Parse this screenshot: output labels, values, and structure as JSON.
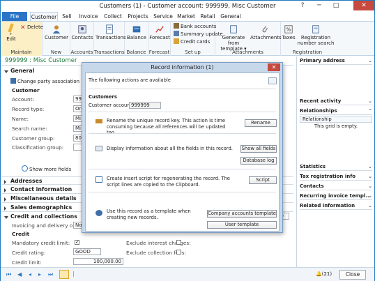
{
  "window": {
    "title": "Customers (1) - Customer account: 999999, Misc Customer",
    "help": "?",
    "minimize": "─",
    "maximize": "□",
    "close": "✕"
  },
  "tabs": [
    "File",
    "Customer",
    "Sell",
    "Invoice",
    "Collect",
    "Projects",
    "Service",
    "Market",
    "Retail",
    "General"
  ],
  "ribbon": {
    "maintain": {
      "edit": "Edit",
      "delete": "Delete",
      "label": "Maintain"
    },
    "new": {
      "customer": "Customer",
      "label": "New"
    },
    "accounts": {
      "contacts": "Contacts",
      "label": "Accounts"
    },
    "transactions": {
      "transactions": "Transactions",
      "label": "Transactions"
    },
    "balance": {
      "balance": "Balance",
      "label": "Balance"
    },
    "forecast": {
      "forecast": "Forecast",
      "label": "Forecast"
    },
    "setup": {
      "bank_accounts": "Bank accounts",
      "summary_update": "Summary update",
      "credit_cards": "Credit cards",
      "label": "Set up"
    },
    "attachments": {
      "generate": "Generate from",
      "template": "template",
      "attachments": "Attachments",
      "label": "Attachments"
    },
    "registration": {
      "taxes": "Taxes",
      "reg1": "Registration",
      "reg2": "number search",
      "label": "Registration"
    }
  },
  "form": {
    "header": "999999 : Misc Customer",
    "general": "General",
    "change_party": "Change party association",
    "customer_section": "Customer",
    "labels": [
      "Account:",
      "Record type:",
      "Name:",
      "Search name:",
      "Customer group:",
      "Classification group:"
    ],
    "values": [
      "999999",
      "Org",
      "Mi",
      "Mi",
      "80",
      ""
    ],
    "show_more": "Show more fields",
    "fasttabs": [
      "Addresses",
      "Contact information",
      "Miscellaneous details",
      "Sales demographics"
    ],
    "credit_tab": "Credit and collections",
    "invoicing_label": "Invoicing and delivery on hold:",
    "invoicing_value": "No",
    "credit_section": "Credit",
    "mandatory": "Mandatory credit limit:",
    "exclude_interest": "Exclude interest charges:",
    "credit_rating": "Credit rating:",
    "credit_rating_value": "GOOD",
    "exclude_fees": "Exclude collection fees:",
    "credit_limit": "Credit limit:",
    "credit_limit_value": "100,000.00"
  },
  "factbox": {
    "primary": "Primary address",
    "recent": "Recent activity",
    "relationships": "Relationships",
    "relationship_col": "Relationship",
    "empty": "This grid is empty.",
    "items": [
      "Statistics",
      "Tax registration info",
      "Contacts",
      "Recurring invoice templ...",
      "Related information"
    ]
  },
  "statusbar": {
    "count": "(21)",
    "close": "Close"
  },
  "dialog": {
    "title": "Record information (1)",
    "intro": "The following actions are available",
    "customers": "Customers",
    "account_label": "Customer account:",
    "account_value": "999999",
    "rename_text": "Rename the unique record key. This action is time consuming because all references will be updated too.",
    "rename_btn": "Rename",
    "fields_text": "Display information about all the fields in this record.",
    "fields_btn": "Show all fields",
    "dblog_btn": "Database log",
    "script_text": "Create insert script for regenerating the record. The script lines are copied to the Clipboard.",
    "script_btn": "Script",
    "template_text": "Use this record as a template when creating new records.",
    "company_btn": "Company accounts template",
    "user_btn": "User template"
  }
}
